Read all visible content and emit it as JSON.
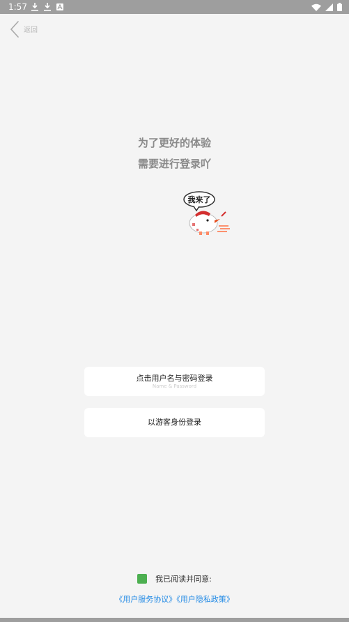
{
  "status_bar": {
    "time": "1:57",
    "left_icons": [
      "download-icon",
      "download-icon",
      "a-notification-icon"
    ],
    "right_icons": [
      "wifi-icon",
      "signal-icon",
      "battery-icon"
    ]
  },
  "nav": {
    "back_label": "返回"
  },
  "headline": {
    "line1": "为了更好的体验",
    "line2": "需要进行登录吖"
  },
  "mascot": {
    "speech": "我来了"
  },
  "buttons": {
    "password_login": "点击用户名与密码登录",
    "password_login_sub": "Name & Password",
    "guest_login": "以游客身份登录"
  },
  "agreement": {
    "checked": true,
    "text": "我已阅读并同意:",
    "service_link": "《用户服务协议》",
    "privacy_link": "《用户隐私政策》"
  },
  "colors": {
    "background": "#f4f4f4",
    "status_bar": "#9e9e9e",
    "checkbox": "#4caf50",
    "link": "#1e88e5",
    "headline": "#8a8a8a"
  }
}
